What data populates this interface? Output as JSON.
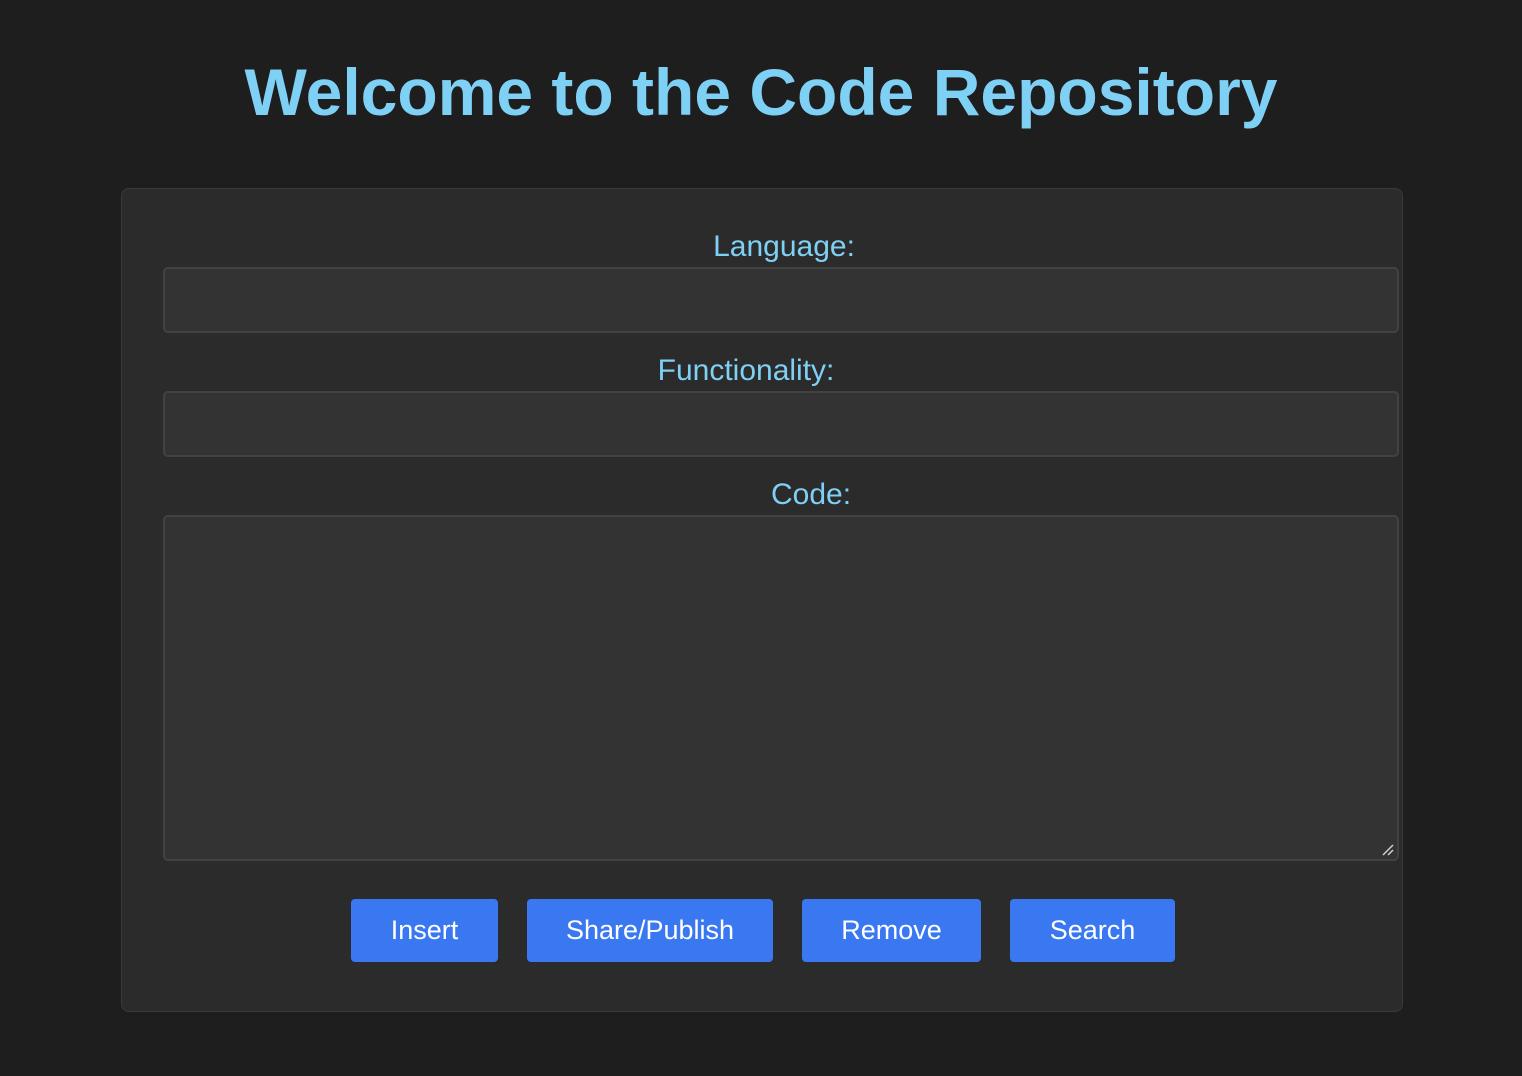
{
  "page": {
    "title": "Welcome to the Code Repository"
  },
  "form": {
    "language": {
      "label": "Language:",
      "value": "",
      "placeholder": ""
    },
    "functionality": {
      "label": "Functionality:",
      "value": "",
      "placeholder": ""
    },
    "code": {
      "label": "Code:",
      "value": "",
      "placeholder": ""
    }
  },
  "actions": {
    "insert_label": "Insert",
    "share_label": "Share/Publish",
    "remove_label": "Remove",
    "search_label": "Search"
  },
  "colors": {
    "background": "#1e1e1e",
    "card": "#2b2b2b",
    "accent_text": "#7fd0f5",
    "button": "#3a78f2",
    "input_bg": "#333333"
  },
  "icons": {
    "resize": "resize-grip-icon"
  }
}
